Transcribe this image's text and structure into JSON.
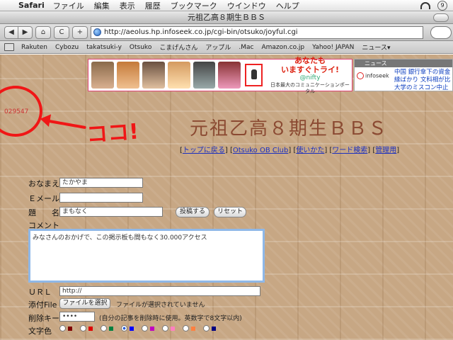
{
  "menubar": {
    "app": "Safari",
    "items": [
      "ファイル",
      "編集",
      "表示",
      "履歴",
      "ブックマーク",
      "ウインドウ",
      "ヘルプ"
    ],
    "clock": "9"
  },
  "window": {
    "title": "元祖乙高８期生ＢＢＳ"
  },
  "toolbar": {
    "back": "◀",
    "forward": "▶",
    "home": "⌂",
    "reload": "C",
    "add": "+",
    "url": "http://aeolus.hp.infoseek.co.jp/cgi-bin/otsuko/joyful.cgi"
  },
  "bookmarks": [
    "Rakuten",
    "Cybozu",
    "takatsuki-y",
    "Otsuko",
    "こまげんさん",
    "アップル",
    ".Mac",
    "Amazon.co.jp",
    "Yahoo! JAPAN",
    "ニュース▾"
  ],
  "banner": {
    "line1": "あなたも",
    "line2": "いますぐトライ!",
    "line3": "@nifty",
    "line4": "日本最大のコミュニケーションポータル"
  },
  "side_banner": {
    "header": "ニュース",
    "logo": "infoseek",
    "news": [
      "中国 銀行傘下の資金",
      "縁ばかり 文科相が比",
      "大学のミスコン中止"
    ]
  },
  "counter": "029547",
  "annotation": "ココ!",
  "bbs": {
    "title": "元祖乙高８期生ＢＢＳ",
    "links": [
      "トップに戻る",
      "Otsuko OB Club",
      "使いかた",
      "ワード検索",
      "管理用"
    ]
  },
  "form": {
    "name_label": "おなまえ",
    "name_value": "たかやま",
    "email_label": "Ｅメール",
    "email_value": "",
    "subject_label": "題　　名",
    "subject_value": "まもなく",
    "submit": "投稿する",
    "reset": "リセット",
    "comment_label": "コメント",
    "comment_value": "みなさんのおかげで、この掲示板も間もなく30.000アクセス",
    "url_label": "ＵＲＬ",
    "url_value": "http://",
    "file_label": "添付File",
    "file_button": "ファイルを選択",
    "file_status": "ファイルが選択されていません",
    "delkey_label": "削除キー",
    "delkey_value": "••••",
    "delkey_note": "(自分の記事を削除時に使用。英数字で8文字以内)",
    "color_label": "文字色",
    "colors": [
      "#800000",
      "#df0000",
      "#008040",
      "#0000ff",
      "#c100c1",
      "#ff80c0",
      "#ff8040",
      "#000080"
    ]
  }
}
